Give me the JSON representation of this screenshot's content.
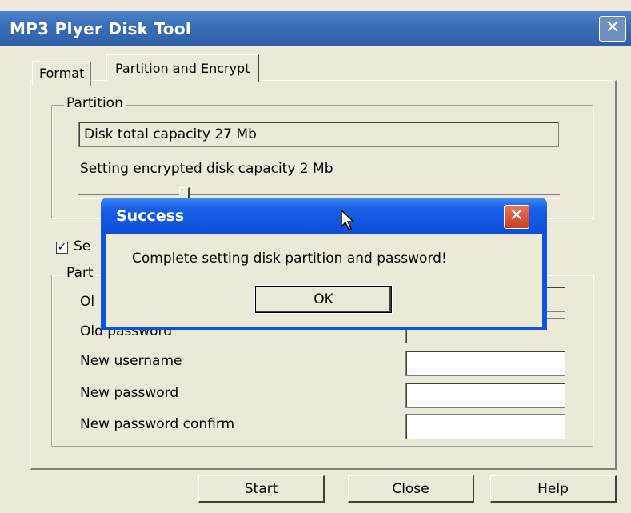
{
  "window": {
    "title": "MP3 Plyer Disk Tool",
    "close_glyph": "✕"
  },
  "tabs": [
    {
      "label": "Format"
    },
    {
      "label": "Partition and Encrypt"
    }
  ],
  "partition": {
    "legend": "Partition",
    "total_capacity": "Disk total capacity 27 Mb",
    "encrypted_capacity": "Setting encrypted disk capacity 2 Mb",
    "slider_level_fraction": 0.21
  },
  "security": {
    "checkbox_label_partial": "Se",
    "checked": true,
    "group_legend_partial": "Part",
    "fields": [
      {
        "label": "Ol",
        "value": ""
      },
      {
        "label": "Old password",
        "value": ""
      },
      {
        "label": "New username",
        "value": ""
      },
      {
        "label": "New password",
        "value": ""
      },
      {
        "label": "New password confirm",
        "value": ""
      }
    ]
  },
  "buttons": {
    "start": "Start",
    "close": "Close",
    "help": "Help"
  },
  "dialog": {
    "title": "Success",
    "message": "Complete setting disk partition and password!",
    "ok": "OK",
    "close_glyph": "✕"
  },
  "colors": {
    "titlebar": "#3a6fb8",
    "dialog_titlebar": "#0a54e0",
    "dialog_close": "#d9532f",
    "face": "#ece9d8"
  }
}
